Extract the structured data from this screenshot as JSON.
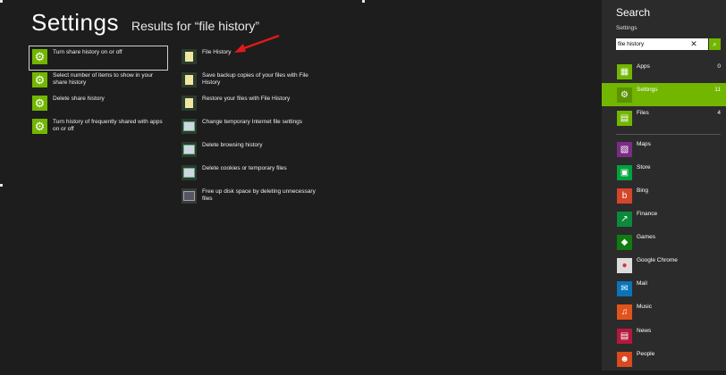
{
  "header": {
    "title": "Settings",
    "subtitle": "Results for “file history”"
  },
  "results_col1": [
    {
      "label": "Turn share history on or off",
      "icon": "gear-icon"
    },
    {
      "label": "Select number of items to show in your share history",
      "icon": "gear-icon"
    },
    {
      "label": "Delete share history",
      "icon": "gear-icon"
    },
    {
      "label": "Turn history of frequently shared with apps on or off",
      "icon": "gear-icon"
    }
  ],
  "results_col2": [
    {
      "label": "File History",
      "icon": "file-history-icon"
    },
    {
      "label": "Save backup copies of your files with File History",
      "icon": "file-history-icon"
    },
    {
      "label": "Restore your files with File History",
      "icon": "file-history-icon"
    },
    {
      "label": "Change temporary Internet file settings",
      "icon": "internet-options-icon"
    },
    {
      "label": "Delete browsing history",
      "icon": "internet-options-icon"
    },
    {
      "label": "Delete cookies or temporary files",
      "icon": "internet-options-icon"
    },
    {
      "label": "Free up disk space by deleting unnecessary files",
      "icon": "disk-cleanup-icon"
    }
  ],
  "search_pane": {
    "title": "Search",
    "scope": "Settings",
    "query": "file history",
    "categories": [
      {
        "label": "Apps",
        "count": "0",
        "icon": "apps-icon",
        "color": "#72b600"
      },
      {
        "label": "Settings",
        "count": "11",
        "icon": "gear-icon",
        "color": "#72b600"
      },
      {
        "label": "Files",
        "count": "4",
        "icon": "files-icon",
        "color": "#72b600"
      }
    ],
    "apps": [
      {
        "label": "Maps",
        "icon": "maps-icon",
        "color": "#7b2c86"
      },
      {
        "label": "Store",
        "icon": "store-icon",
        "color": "#00a13e"
      },
      {
        "label": "Bing",
        "icon": "bing-icon",
        "color": "#d4452a"
      },
      {
        "label": "Finance",
        "icon": "finance-icon",
        "color": "#0a8a3a"
      },
      {
        "label": "Games",
        "icon": "games-icon",
        "color": "#107c10"
      },
      {
        "label": "Google Chrome",
        "icon": "chrome-icon",
        "color": "#dcdcdc"
      },
      {
        "label": "Mail",
        "icon": "mail-icon",
        "color": "#0a74b8"
      },
      {
        "label": "Music",
        "icon": "music-icon",
        "color": "#e2531b"
      },
      {
        "label": "News",
        "icon": "news-icon",
        "color": "#b4183d"
      },
      {
        "label": "People",
        "icon": "people-icon",
        "color": "#d94a1e"
      }
    ]
  },
  "colors": {
    "accent": "#72b600",
    "background": "#1d1d1d",
    "pane": "#2b2b2b",
    "annotation_arrow": "#e01a1a"
  }
}
